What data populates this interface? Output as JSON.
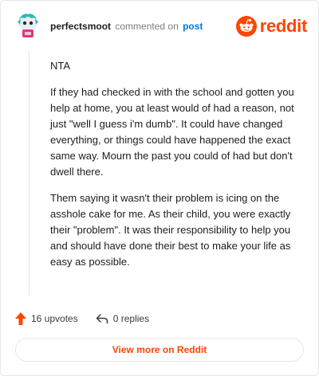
{
  "header": {
    "username": "perfectsmoot",
    "action_text": "commented on",
    "post_link": "post",
    "brand": "reddit"
  },
  "comment": {
    "paragraphs": [
      "NTA",
      "If they had checked in with the school and gotten you help at home, you at least would of had a reason, not just \"well I guess i'm dumb\". It could have changed everything, or things could have happened the exact same way. Mourn the past you could of had but don't dwell there.",
      "Them saying it wasn't their problem is icing on the asshole cake for me. As their child, you were exactly their \"problem\". It was their responsibility to help you and should have done their best to make your life as easy as possible."
    ]
  },
  "actions": {
    "upvotes_label": "16 upvotes",
    "replies_label": "0 replies"
  },
  "footer": {
    "view_more_label": "View more on Reddit"
  },
  "colors": {
    "brand": "#ff4500",
    "link": "#0079d3",
    "upvote": "#ff4500"
  }
}
